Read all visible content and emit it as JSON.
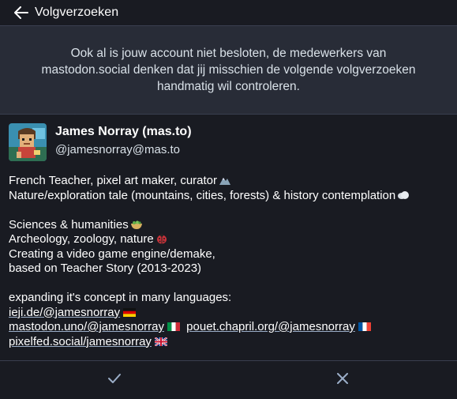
{
  "header": {
    "title": "Volgverzoeken",
    "back_icon": "arrow-left-icon"
  },
  "notice": {
    "text": "Ook al is jouw account niet besloten, de medewerkers van mastodon.social denken dat jij misschien de volgende volgverzoeken handmatig wil controleren."
  },
  "account": {
    "display_name": "James Norray (mas.to)",
    "acct": "@jamesnorray@mas.to",
    "bio": {
      "line1": "French Teacher, pixel art maker, curator",
      "line2": "Nature/exploration tale (mountains, cities, forests) & history contemplation",
      "line3": "Sciences & humanities",
      "line4": "Archeology, zoology, nature",
      "line5": "Creating a video game engine/demake,",
      "line6": "based on Teacher Story (2013-2023)",
      "line7": "expanding it's concept in many languages:",
      "links": [
        {
          "text": "ieji.de/@jamesnorray",
          "flag": "flag-germany-icon"
        },
        {
          "text": "mastodon.uno/@jamesnorray",
          "flag": "flag-italy-icon"
        },
        {
          "text": "pouet.chapril.org/@jamesnorray",
          "flag": "flag-france-icon"
        },
        {
          "text": "pixelfed.social/jamesnorray",
          "flag": "flag-uk-icon"
        }
      ]
    }
  },
  "actions": {
    "accept_icon": "check-icon",
    "reject_icon": "close-icon"
  },
  "colors": {
    "background": "#191b22",
    "notice_bg": "#282c37",
    "border": "#393f4f",
    "text": "#ffffff",
    "secondary_text": "#d9e1e8",
    "icon": "#9baec8"
  }
}
